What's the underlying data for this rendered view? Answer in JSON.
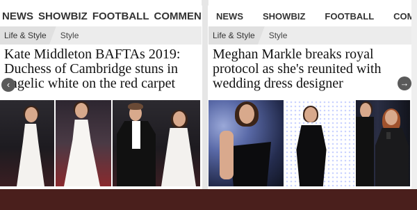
{
  "left": {
    "nav": [
      "NEWS",
      "SHOWBIZ",
      "FOOTBALL",
      "COMMENT"
    ],
    "crumbs": [
      "Life & Style",
      "Style"
    ],
    "headline": "Kate Middleton BAFTAs 2019: Duchess of Cambridge stuns in angelic white on the red carpet",
    "prev_icon": "chevron-left-icon"
  },
  "right": {
    "nav": [
      "NEWS",
      "SHOWBIZ",
      "FOOTBALL",
      "COMMENT"
    ],
    "crumbs": [
      "Life & Style",
      "Style"
    ],
    "headline": "Meghan Markle breaks royal protocol as she's reunited with wedding dress designer",
    "next_icon": "arrow-right-icon"
  },
  "colors": {
    "bottom_bar": "#4a1f1c",
    "text": "#111111",
    "subnav": "#ececec"
  }
}
